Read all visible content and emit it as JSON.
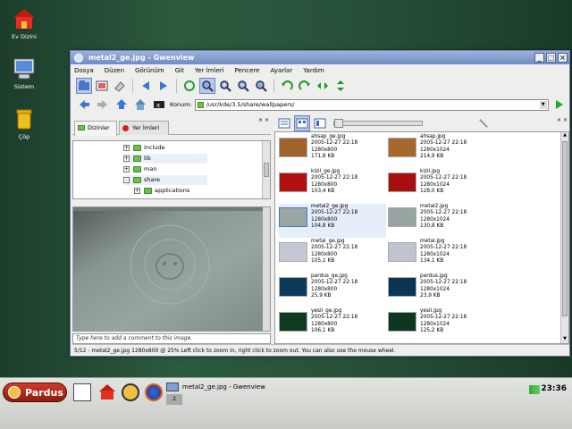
{
  "desktop": {
    "icons": [
      {
        "label": "Ev Dizini",
        "icon": "home-icon"
      },
      {
        "label": "Sistem",
        "icon": "computer-icon"
      },
      {
        "label": "Çöp",
        "icon": "trash-icon"
      }
    ]
  },
  "window": {
    "title": "metal2_ge.jpg - Gwenview",
    "menu": [
      "Dosya",
      "Düzen",
      "Görünüm",
      "Git",
      "Yer İmleri",
      "Pencere",
      "Ayarlar",
      "Yardım"
    ],
    "location_label": "Konum:",
    "location_value": "/usr/kde/3.5/share/wallpapers/",
    "tabs": [
      "Dizinler",
      "Yer İmleri"
    ],
    "tree": [
      {
        "label": "include",
        "expand": "+"
      },
      {
        "label": "lib",
        "expand": "+"
      },
      {
        "label": "man",
        "expand": "+"
      },
      {
        "label": "share",
        "expand": "-"
      },
      {
        "label": "applications",
        "expand": "+"
      }
    ],
    "comment_placeholder": "Type here to add a comment to this image.",
    "files": [
      {
        "name": "ahsap_ge.jpg",
        "date": "2005-12-27 22:18",
        "dims": "1280x800",
        "size": "171,8 KB",
        "color": "#a0612a"
      },
      {
        "name": "ahsap.jpg",
        "date": "2005-12-27 22:18",
        "dims": "1280x1024",
        "size": "214,9 KB",
        "color": "#a8672c"
      },
      {
        "name": "kizil_ge.jpg",
        "date": "2005-12-27 22:18",
        "dims": "1280x800",
        "size": "103,4 KB",
        "color": "#b01010"
      },
      {
        "name": "kizil.jpg",
        "date": "2005-12-27 22:18",
        "dims": "1280x1024",
        "size": "128,0 KB",
        "color": "#a80e0e"
      },
      {
        "name": "metal2_ge.jpg",
        "date": "2005-12-27 22:18",
        "dims": "1280x800",
        "size": "104,8 KB",
        "color": "#9aa6a4"
      },
      {
        "name": "metal2.jpg",
        "date": "2005-12-27 22:18",
        "dims": "1280x1024",
        "size": "130,8 KB",
        "color": "#98a4a2"
      },
      {
        "name": "metal_ge.jpg",
        "date": "2005-12-27 22:18",
        "dims": "1280x800",
        "size": "105,1 KB",
        "color": "#c4c8d4"
      },
      {
        "name": "metal.jpg",
        "date": "2005-12-27 22:18",
        "dims": "1280x1024",
        "size": "134,1 KB",
        "color": "#c0c4d0"
      },
      {
        "name": "pardus_ge.jpg",
        "date": "2005-12-27 22:18",
        "dims": "1280x800",
        "size": "25,9 KB",
        "color": "#0e3a5a"
      },
      {
        "name": "pardus.jpg",
        "date": "2005-12-27 22:18",
        "dims": "1280x1024",
        "size": "23,9 KB",
        "color": "#0c3454"
      },
      {
        "name": "yesil_ge.jpg",
        "date": "2005-12-27 22:18",
        "dims": "1280x800",
        "size": "106,1 KB",
        "color": "#0f3a22"
      },
      {
        "name": "yesil.jpg",
        "date": "2005-12-27 22:18",
        "dims": "1280x1024",
        "size": "125,2 KB",
        "color": "#0d3620"
      }
    ],
    "status": "5/12 - metal2_ge.jpg 1280x800 @ 25%  Left click to zoom in, right click to zoom out. You can also use the mouse wheel."
  },
  "taskbar": {
    "start": "Pardus",
    "task": "metal2_ge.jpg - Gwenview",
    "desk_num": "2",
    "clock": "23:36"
  }
}
